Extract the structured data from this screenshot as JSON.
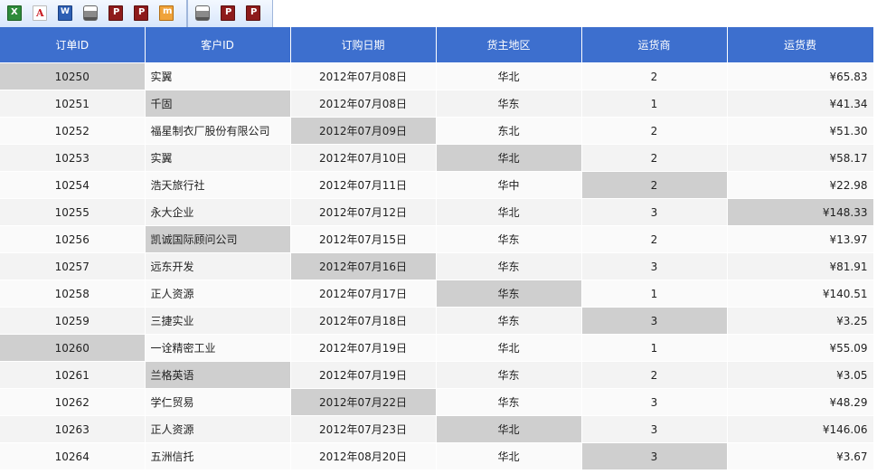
{
  "toolbar": {
    "group1": [
      {
        "name": "export-excel-icon",
        "cls": "ico-excel"
      },
      {
        "name": "export-pdf-icon",
        "cls": "ico-pdf"
      },
      {
        "name": "export-word-icon",
        "cls": "ico-word"
      },
      {
        "name": "print-icon",
        "cls": "ico-print"
      },
      {
        "name": "print-pdf-icon",
        "cls": "ico-red"
      },
      {
        "name": "print-preview-icon",
        "cls": "ico-red"
      },
      {
        "name": "export-image-icon",
        "cls": "ico-img"
      }
    ],
    "group2": [
      {
        "name": "print-icon",
        "cls": "ico-print"
      },
      {
        "name": "print-pdf-icon",
        "cls": "ico-red"
      },
      {
        "name": "print-preview-icon",
        "cls": "ico-red"
      }
    ]
  },
  "table": {
    "headers": [
      "订单ID",
      "客户ID",
      "订购日期",
      "货主地区",
      "运货商",
      "运货费"
    ],
    "rows": [
      {
        "order_id": "10250",
        "customer": "实翼",
        "date": "2012年07月08日",
        "region": "华北",
        "shipper": "2",
        "freight": "¥65.83"
      },
      {
        "order_id": "10251",
        "customer": "千固",
        "date": "2012年07月08日",
        "region": "华东",
        "shipper": "1",
        "freight": "¥41.34"
      },
      {
        "order_id": "10252",
        "customer": "福星制衣厂股份有限公司",
        "date": "2012年07月09日",
        "region": "东北",
        "shipper": "2",
        "freight": "¥51.30"
      },
      {
        "order_id": "10253",
        "customer": "实翼",
        "date": "2012年07月10日",
        "region": "华北",
        "shipper": "2",
        "freight": "¥58.17"
      },
      {
        "order_id": "10254",
        "customer": "浩天旅行社",
        "date": "2012年07月11日",
        "region": "华中",
        "shipper": "2",
        "freight": "¥22.98"
      },
      {
        "order_id": "10255",
        "customer": "永大企业",
        "date": "2012年07月12日",
        "region": "华北",
        "shipper": "3",
        "freight": "¥148.33"
      },
      {
        "order_id": "10256",
        "customer": "凯诚国际顾问公司",
        "date": "2012年07月15日",
        "region": "华东",
        "shipper": "2",
        "freight": "¥13.97"
      },
      {
        "order_id": "10257",
        "customer": "远东开发",
        "date": "2012年07月16日",
        "region": "华东",
        "shipper": "3",
        "freight": "¥81.91"
      },
      {
        "order_id": "10258",
        "customer": "正人资源",
        "date": "2012年07月17日",
        "region": "华东",
        "shipper": "1",
        "freight": "¥140.51"
      },
      {
        "order_id": "10259",
        "customer": "三捷实业",
        "date": "2012年07月18日",
        "region": "华东",
        "shipper": "3",
        "freight": "¥3.25"
      },
      {
        "order_id": "10260",
        "customer": "一诠精密工业",
        "date": "2012年07月19日",
        "region": "华北",
        "shipper": "1",
        "freight": "¥55.09"
      },
      {
        "order_id": "10261",
        "customer": "兰格英语",
        "date": "2012年07月19日",
        "region": "华东",
        "shipper": "2",
        "freight": "¥3.05"
      },
      {
        "order_id": "10262",
        "customer": "学仁贸易",
        "date": "2012年07月22日",
        "region": "华东",
        "shipper": "3",
        "freight": "¥48.29"
      },
      {
        "order_id": "10263",
        "customer": "正人资源",
        "date": "2012年07月23日",
        "region": "华北",
        "shipper": "3",
        "freight": "¥146.06"
      },
      {
        "order_id": "10264",
        "customer": "五洲信托",
        "date": "2012年08月20日",
        "region": "华北",
        "shipper": "3",
        "freight": "¥3.67"
      }
    ]
  }
}
